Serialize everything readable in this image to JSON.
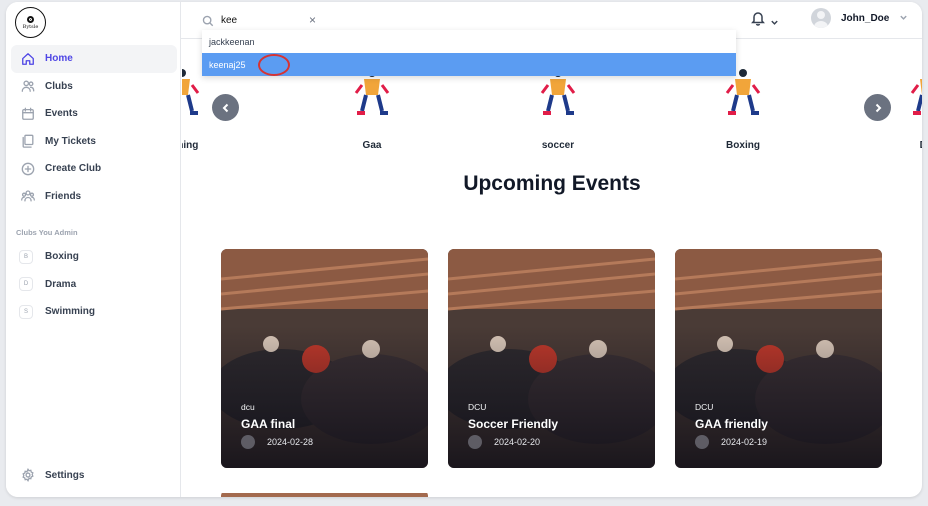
{
  "app": {
    "logo_text": "Bytsle"
  },
  "sidebar": {
    "nav": [
      {
        "label": "Home",
        "icon": "home-icon",
        "active": true
      },
      {
        "label": "Clubs",
        "icon": "users-icon"
      },
      {
        "label": "Events",
        "icon": "calendar-icon"
      },
      {
        "label": "My Tickets",
        "icon": "tickets-icon"
      },
      {
        "label": "Create Club",
        "icon": "plus-circle-icon"
      },
      {
        "label": "Friends",
        "icon": "friends-icon"
      }
    ],
    "admin_title": "Clubs You Admin",
    "admin_clubs": [
      {
        "badge": "B",
        "label": "Boxing"
      },
      {
        "badge": "D",
        "label": "Drama"
      },
      {
        "badge": "S",
        "label": "Swimming"
      }
    ],
    "settings_label": "Settings"
  },
  "header": {
    "search_value": "kee",
    "clear_glyph": "×",
    "username": "John_Doe"
  },
  "search_suggestions": [
    {
      "label": "jackkeenan"
    },
    {
      "label": "keenaj25",
      "selected": true
    }
  ],
  "categories": [
    "mming",
    "Gaa",
    "soccer",
    "Boxing",
    "Dra"
  ],
  "upcoming_title": "Upcoming Events",
  "events": [
    {
      "club": "dcu",
      "title": "GAA final",
      "date": "2024-02-28"
    },
    {
      "club": "DCU",
      "title": "Soccer Friendly",
      "date": "2024-02-20"
    },
    {
      "club": "DCU",
      "title": "GAA friendly",
      "date": "2024-02-19"
    }
  ],
  "colors": {
    "accent": "#4f46e5",
    "selection": "#5b9cf2",
    "cursor_ring": "#d63333"
  }
}
